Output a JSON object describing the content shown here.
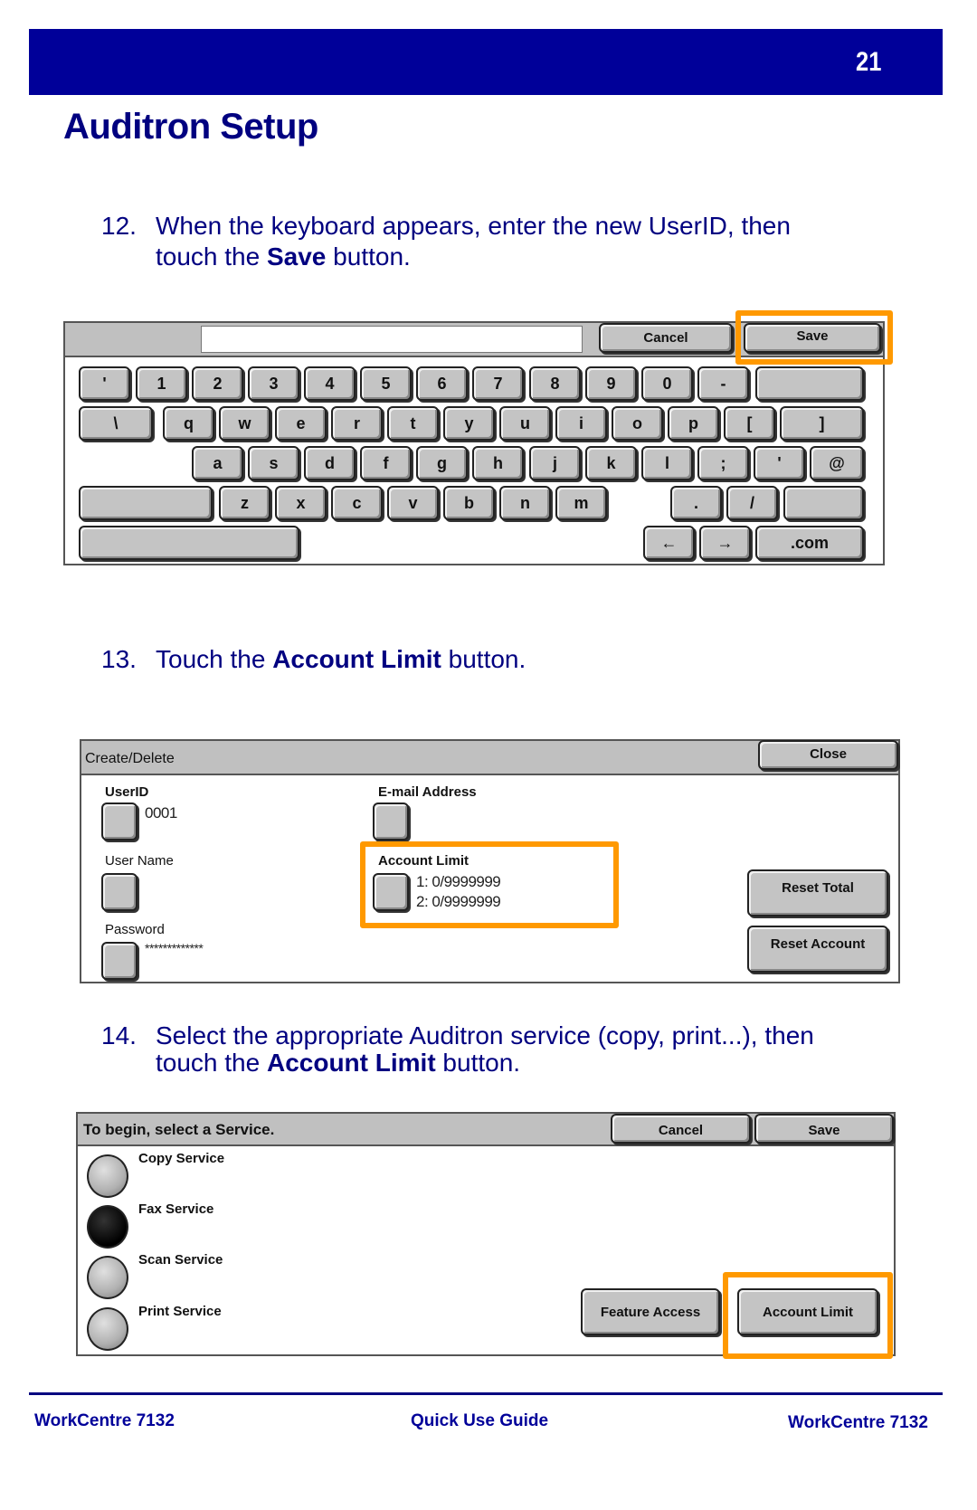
{
  "header": {
    "page_number": "21"
  },
  "title": "Auditron Setup",
  "steps": [
    {
      "num": "12.",
      "line1": "When the keyboard appears, enter the new UserID, then",
      "line2_pre": "touch the ",
      "line2_bold": "Save",
      "line2_post": " button."
    },
    {
      "num": "13.",
      "line1_pre": "Touch the ",
      "line1_bold": "Account Limit",
      "line1_post": " button."
    },
    {
      "num": "14.",
      "line1": "Select the appropriate Auditron service (copy, print...), then",
      "line2_pre": "touch the ",
      "line2_bold": "Account Limit",
      "line2_post": " button."
    }
  ],
  "keyboard_screen": {
    "input_value": "",
    "cancel_label": "Cancel",
    "save_label": "Save",
    "rows": [
      [
        "'",
        "1",
        "2",
        "3",
        "4",
        "5",
        "6",
        "7",
        "8",
        "9",
        "0",
        "-",
        ""
      ],
      [
        "\\",
        "q",
        "w",
        "e",
        "r",
        "t",
        "y",
        "u",
        "i",
        "o",
        "p",
        "[",
        "]"
      ],
      [
        "a",
        "s",
        "d",
        "f",
        "g",
        "h",
        "j",
        "k",
        "l",
        ";",
        "'",
        "@"
      ],
      [
        "",
        "z",
        "x",
        "c",
        "v",
        "b",
        "n",
        "m",
        ".",
        "/",
        ""
      ],
      [
        "",
        "←",
        "→",
        ".com"
      ]
    ]
  },
  "create_delete_screen": {
    "bar_title": "Create/Delete",
    "close_label": "Close",
    "userid_label": "UserID",
    "userid_value": "0001",
    "email_label": "E-mail Address",
    "username_label": "User Name",
    "account_limit_label": "Account Limit",
    "account_limit_line1": "1: 0/9999999",
    "account_limit_line2": "2: 0/9999999",
    "password_label": "Password",
    "password_value": "*************",
    "reset_total_label": "Reset Total",
    "reset_account_label": "Reset Account"
  },
  "service_screen": {
    "bar_title": "To begin, select a Service.",
    "cancel_label": "Cancel",
    "save_label": "Save",
    "services": [
      {
        "label": "Copy Service",
        "selected": false
      },
      {
        "label": "Fax Service",
        "selected": true
      },
      {
        "label": "Scan Service",
        "selected": false
      },
      {
        "label": "Print Service",
        "selected": false
      }
    ],
    "feature_access_label": "Feature Access",
    "account_limit_label": "Account Limit"
  },
  "footer": {
    "left": "WorkCentre 7132",
    "center": "Quick Use Guide",
    "right": "WorkCentre 7132"
  }
}
